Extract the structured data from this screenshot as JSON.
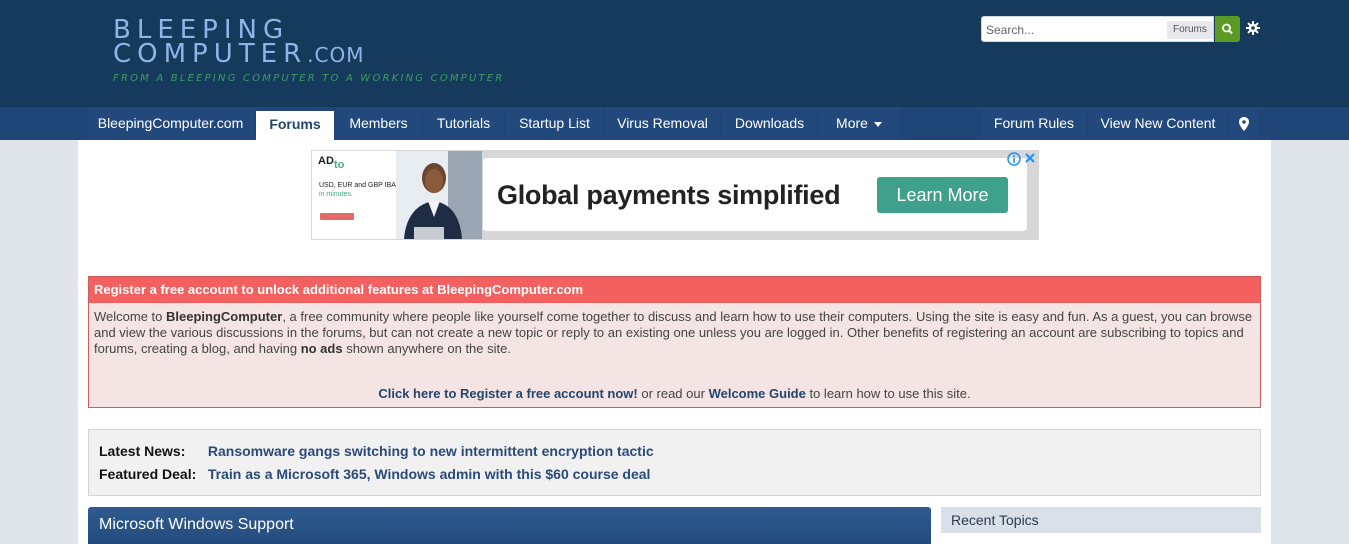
{
  "header": {
    "logo_line1": "BLEEPING",
    "logo_line2": "COMPUTER",
    "logo_dotcom": ".COM",
    "tagline": "FROM A BLEEPING COMPUTER TO A WORKING COMPUTER",
    "search_placeholder": "Search...",
    "search_scope": "Forums"
  },
  "nav": {
    "items": [
      "BleepingComputer.com",
      "Forums",
      "Members",
      "Tutorials",
      "Startup List",
      "Virus Removal",
      "Downloads",
      "More"
    ],
    "active": "Forums",
    "right_items": [
      "Forum Rules",
      "View New Content"
    ]
  },
  "ad": {
    "label": "AD",
    "brand": "to",
    "small_text_1": "USD, EUR and GBP IBANs",
    "small_text_2": "in minutes.",
    "headline": "Global payments simplified",
    "cta": "Learn More"
  },
  "register": {
    "title": "Register a free account to unlock additional features at BleepingComputer.com",
    "p1": "Welcome to ",
    "p1_bold": "BleepingComputer",
    "p2": ", a free community where people like yourself come together to discuss and learn how to use their computers. Using the site is easy and fun. As a guest, you can browse and view the various discussions in the forums, but can not create a new topic or reply to an existing one unless you are logged in. Other benefits of registering an account are subscribing to topics and forums, creating a blog, and having ",
    "p2_bold": "no ads",
    "p3": " shown anywhere on the site.",
    "cta_link": "Click here to Register a free account now!",
    "cta_mid": " or read our ",
    "cta_guide": "Welcome Guide",
    "cta_end": " to learn how to use this site."
  },
  "news": {
    "latest_label": "Latest News:",
    "latest_link": "Ransomware gangs switching to new intermittent encryption tactic",
    "deal_label": "Featured Deal:",
    "deal_link": "Train as a Microsoft 365, Windows admin with this $60 course deal"
  },
  "panels": {
    "support_title": "Microsoft Windows Support",
    "recent_title": "Recent Topics"
  },
  "colors": {
    "header_bg": "#163a5c",
    "nav_bg": "#1f4677",
    "register_title_bg": "#f36060",
    "ad_cta": "#3fa08c",
    "search_btn": "#5b9a25"
  }
}
